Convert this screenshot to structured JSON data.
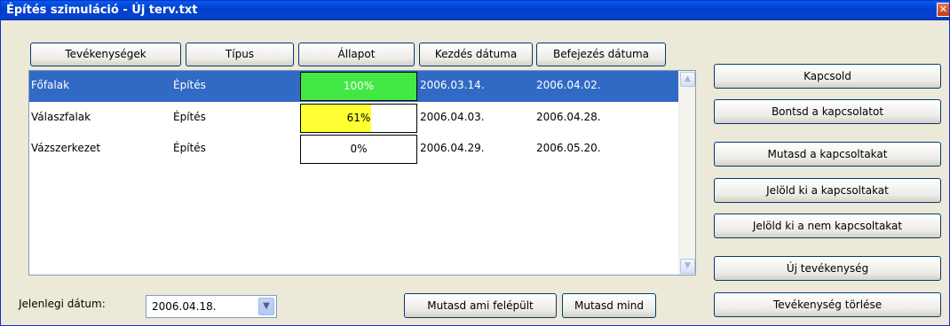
{
  "window": {
    "title": "Építés szimuláció - Új terv.txt",
    "close_glyph": "✕"
  },
  "columns": [
    "Tevékenységek",
    "Típus",
    "Állapot",
    "Kezdés dátuma",
    "Befejezés dátuma"
  ],
  "rows": [
    {
      "name": "Főfalak",
      "type": "Építés",
      "progress": 100,
      "progress_label": "100%",
      "progress_color": "#44e844",
      "start": "2006.03.14.",
      "end": "2006.04.02.",
      "selected": true
    },
    {
      "name": "Válaszfalak",
      "type": "Építés",
      "progress": 61,
      "progress_label": "61%",
      "progress_color": "#ffff33",
      "start": "2006.04.03.",
      "end": "2006.04.28.",
      "selected": false
    },
    {
      "name": "Vázszerkezet",
      "type": "Építés",
      "progress": 0,
      "progress_label": "0%",
      "progress_color": "#ffffff",
      "start": "2006.04.29.",
      "end": "2006.05.20.",
      "selected": false
    }
  ],
  "side_buttons": {
    "connect": "Kapcsold",
    "disconnect": "Bontsd a kapcsolatot",
    "show_connected": "Mutasd a kapcsoltakat",
    "mark_connected": "Jelöld ki a kapcsoltakat",
    "mark_unconnected": "Jelöld ki a nem kapcsoltakat",
    "new_activity": "Új tevékenység",
    "delete_activity": "Tevékenység törlése"
  },
  "bottom": {
    "date_label": "Jelenlegi dátum:",
    "date_value": "2006.04.18.",
    "show_built": "Mutasd ami felépült",
    "show_all": "Mutasd mind"
  },
  "icons": {
    "scroll_up": "chevron-up-icon",
    "scroll_down": "chevron-down-icon",
    "combo_arrow": "chevron-down-icon"
  }
}
